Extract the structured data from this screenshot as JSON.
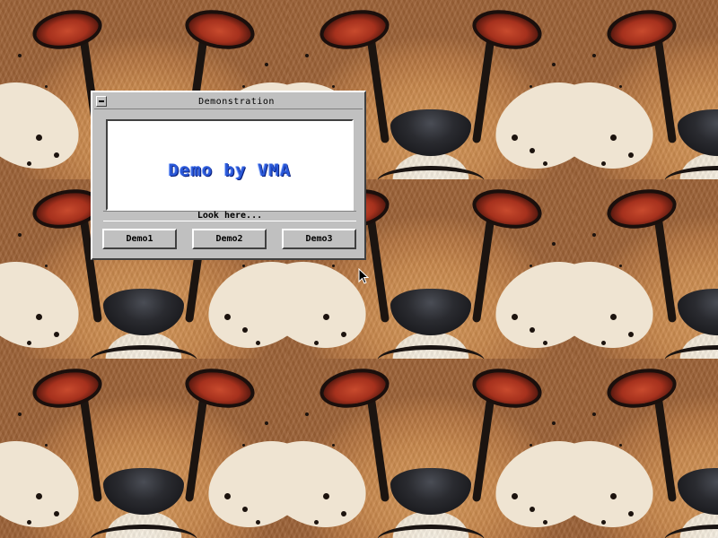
{
  "window": {
    "title": "Demonstration",
    "display_text": "Demo by VMA",
    "status_text": "Look here...",
    "buttons": [
      {
        "label": "Demo1"
      },
      {
        "label": "Demo2"
      },
      {
        "label": "Demo3"
      }
    ]
  },
  "desktop": {
    "wallpaper": "tiled-cheetah-face"
  },
  "icons": {
    "system_menu": "minus-icon",
    "cursor": "arrow-cursor-icon"
  },
  "colors": {
    "window_face": "#c0c0c0",
    "display_bg": "#ffffff",
    "display_text": "#2a58d8"
  }
}
